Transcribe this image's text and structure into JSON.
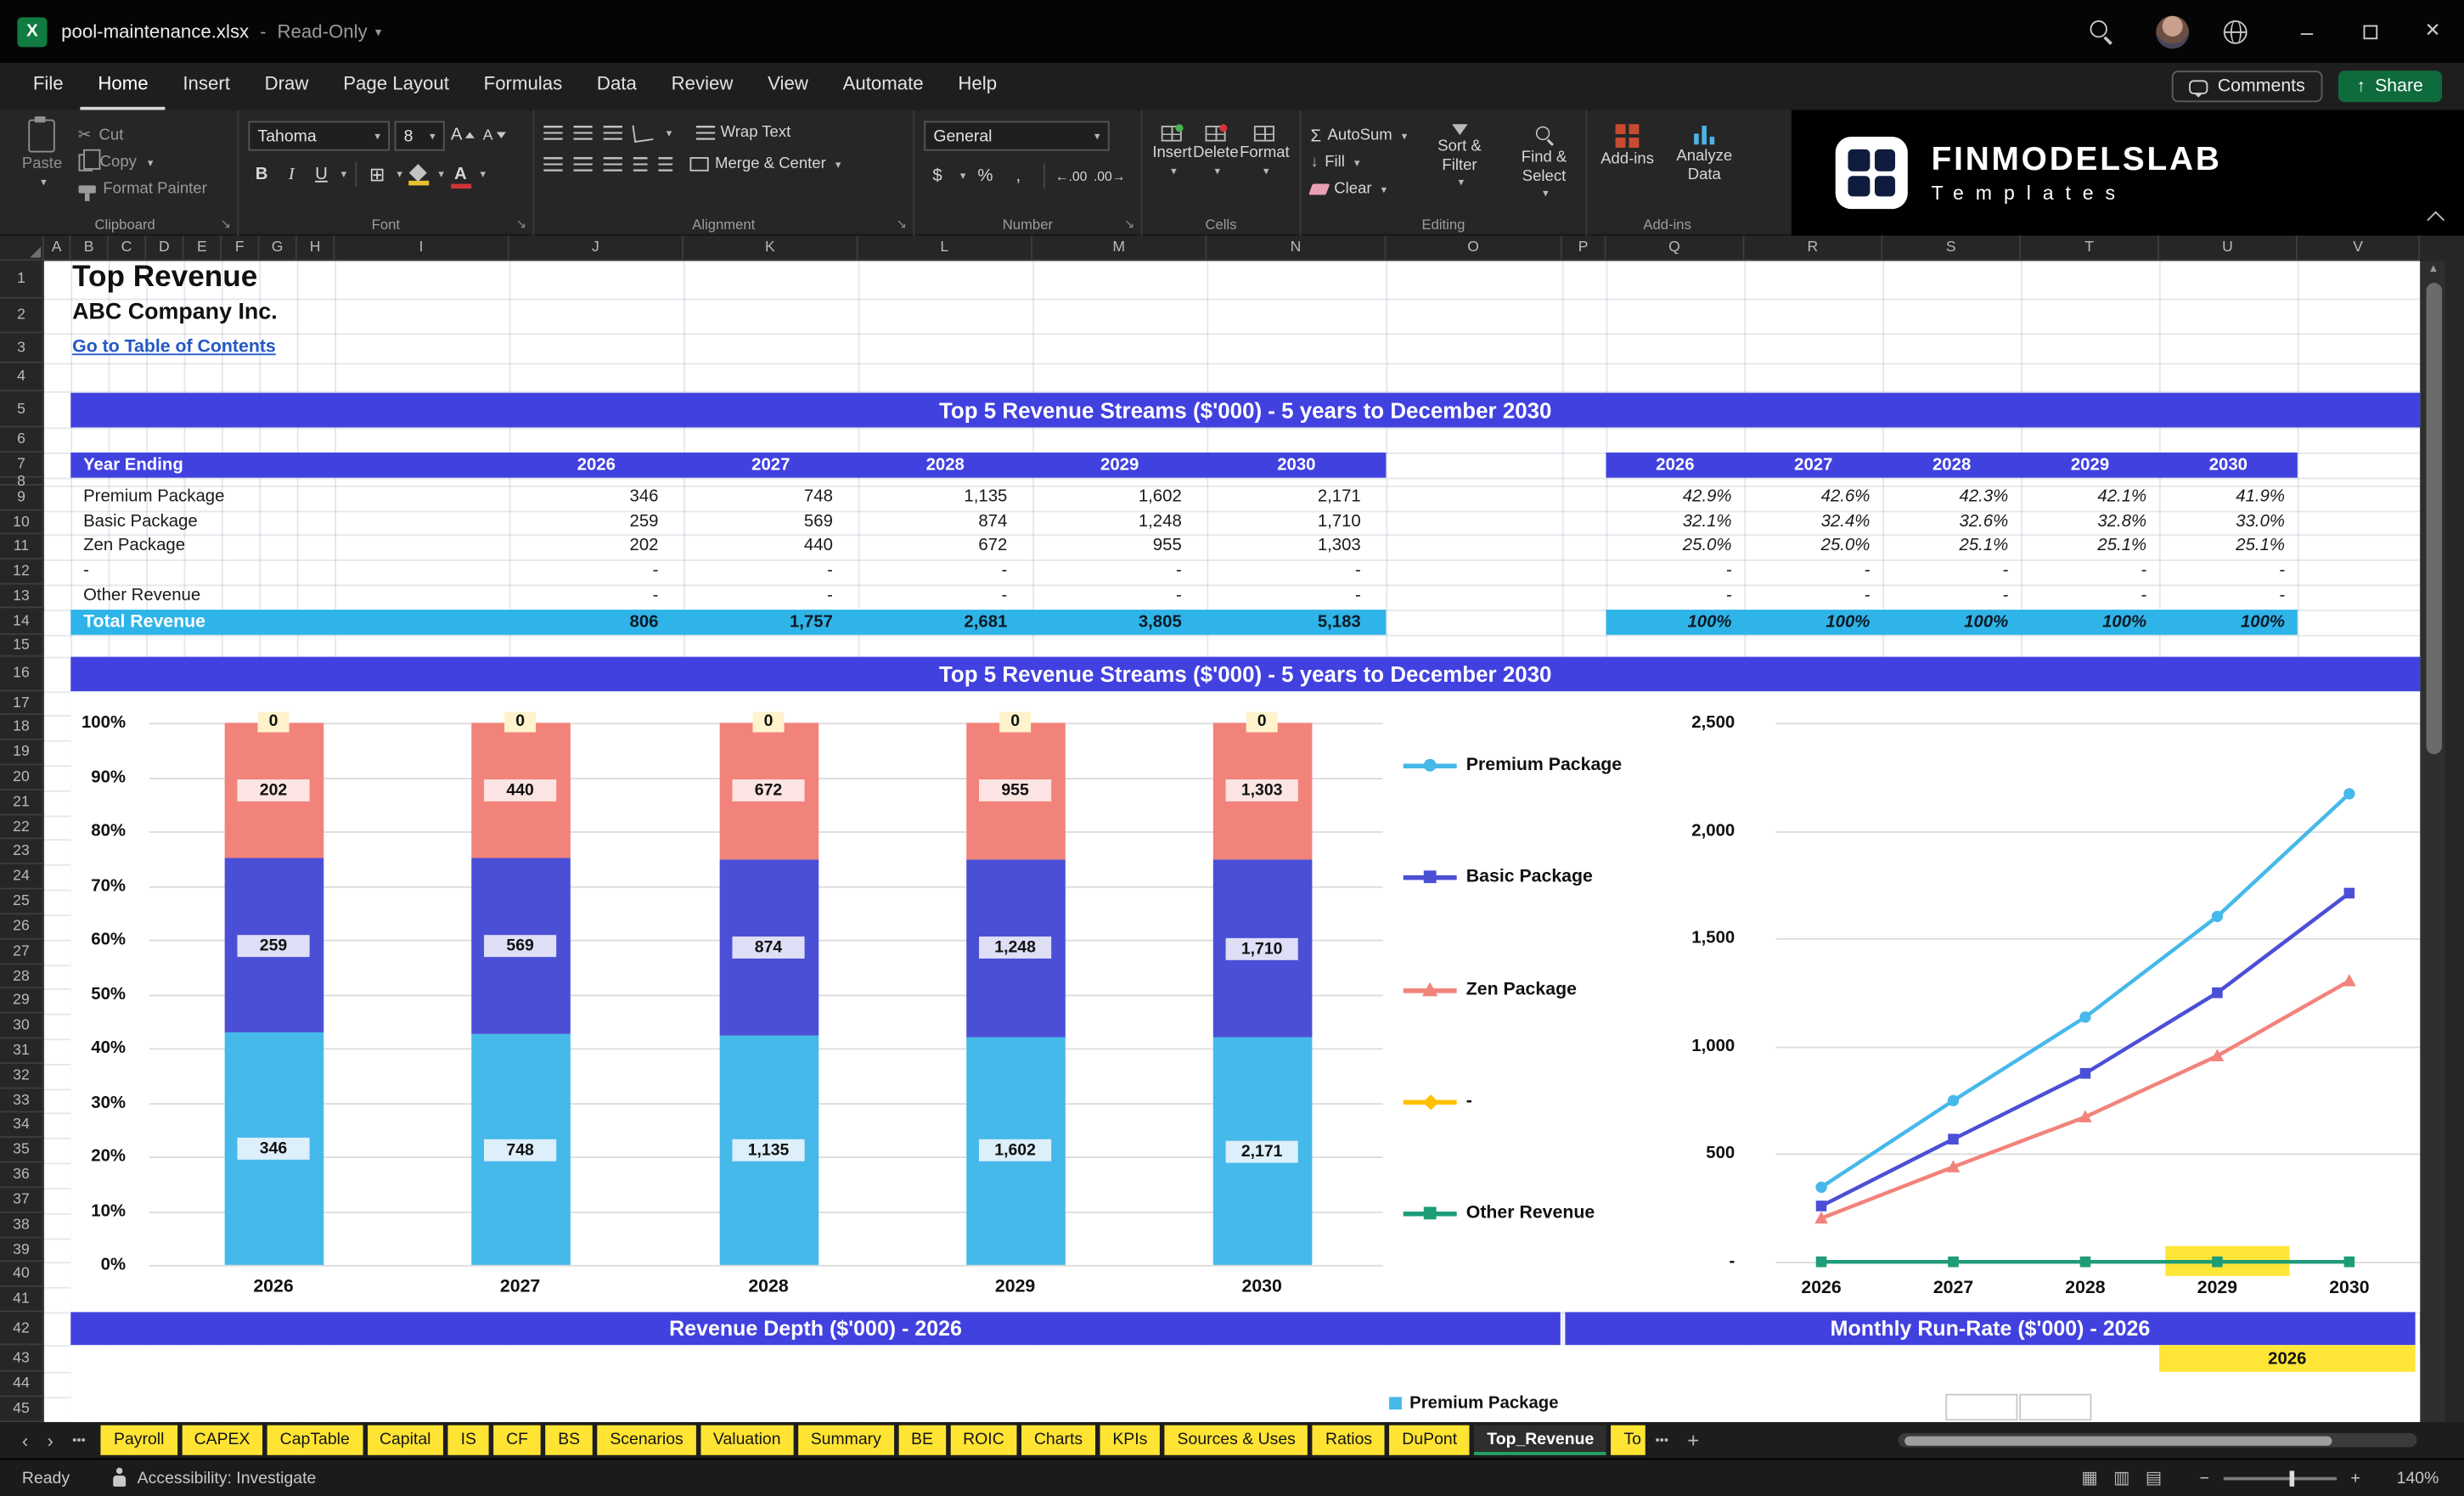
{
  "colors": {
    "banner_blue": "#4141E0",
    "total_cyan": "#2EB4E8",
    "premium_blue": "#45B9E9",
    "basic_indigo": "#4B4FD6",
    "zen_salmon": "#F2837B",
    "dash_yellow": "#FFC000",
    "other_green": "#1E9C78",
    "tab_yellow": "#FFE433",
    "highlight_yellow": "#FFE535",
    "link_blue": "#2257C5"
  },
  "title_bar": {
    "filename": "pool-maintenance.xlsx",
    "dash": "-",
    "mode": "Read-Only"
  },
  "menu": {
    "items": [
      "File",
      "Home",
      "Insert",
      "Draw",
      "Page Layout",
      "Formulas",
      "Data",
      "Review",
      "View",
      "Automate",
      "Help"
    ],
    "active": "Home",
    "comments": "Comments",
    "share": "Share"
  },
  "ribbon": {
    "clipboard": {
      "group": "Clipboard",
      "paste": "Paste",
      "cut": "Cut",
      "copy": "Copy",
      "format_painter": "Format Painter"
    },
    "font": {
      "group": "Font",
      "name": "Tahoma",
      "size": "8",
      "bold": "B",
      "italic": "I",
      "underline": "U",
      "grow": "A",
      "shrink": "A"
    },
    "alignment": {
      "group": "Alignment",
      "wrap": "Wrap Text",
      "merge": "Merge & Center"
    },
    "number": {
      "group": "Number",
      "format": "General",
      "currency": "$",
      "percent": "%",
      "comma": ",",
      "inc_decimal": "←.00",
      "dec_decimal": ".00→"
    },
    "cells": {
      "group": "Cells",
      "insert": "Insert",
      "delete": "Delete",
      "format": "Format"
    },
    "editing": {
      "group": "Editing",
      "autosum": "AutoSum",
      "fill": "Fill",
      "clear": "Clear",
      "sort": "Sort & Filter",
      "find": "Find & Select"
    },
    "addins": {
      "group": "Add-ins",
      "addins": "Add-ins",
      "analyze": "Analyze Data"
    },
    "brand": {
      "name": "FINMODELSLAB",
      "sub": "Templates"
    }
  },
  "grid": {
    "columns": [
      "A",
      "B",
      "C",
      "D",
      "E",
      "F",
      "G",
      "H",
      "I",
      "J",
      "K",
      "L",
      "M",
      "N",
      "O",
      "P",
      "Q",
      "R",
      "S",
      "T",
      "U",
      "V"
    ],
    "row_from": 1,
    "row_to": 45
  },
  "sheet": {
    "title": "Top Revenue",
    "company": "ABC Company Inc.",
    "toc_link": "Go to Table of Contents",
    "banner_top": "Top 5 Revenue Streams ($'000) - 5 years to December 2030",
    "banner_chart": "Top 5 Revenue Streams ($'000) - 5 years to December 2030",
    "banner_depth": "Revenue Depth ($'000) - 2026",
    "banner_runrate": "Monthly Run-Rate ($'000) - 2026",
    "year_cell": "2026",
    "partial_legend": "Premium Package",
    "table": {
      "header": "Year Ending",
      "years": [
        "2026",
        "2027",
        "2028",
        "2029",
        "2030"
      ],
      "rows": [
        {
          "label": "Premium Package",
          "values": [
            "346",
            "748",
            "1,135",
            "1,602",
            "2,171"
          ],
          "pcts": [
            "42.9%",
            "42.6%",
            "42.3%",
            "42.1%",
            "41.9%"
          ]
        },
        {
          "label": "Basic Package",
          "values": [
            "259",
            "569",
            "874",
            "1,248",
            "1,710"
          ],
          "pcts": [
            "32.1%",
            "32.4%",
            "32.6%",
            "32.8%",
            "33.0%"
          ]
        },
        {
          "label": "Zen Package",
          "values": [
            "202",
            "440",
            "672",
            "955",
            "1,303"
          ],
          "pcts": [
            "25.0%",
            "25.0%",
            "25.1%",
            "25.1%",
            "25.1%"
          ]
        },
        {
          "label": "-",
          "values": [
            "-",
            "-",
            "-",
            "-",
            "-"
          ],
          "pcts": [
            "-",
            "-",
            "-",
            "-",
            "-"
          ]
        },
        {
          "label": "Other Revenue",
          "values": [
            "-",
            "-",
            "-",
            "-",
            "-"
          ],
          "pcts": [
            "-",
            "-",
            "-",
            "-",
            "-"
          ]
        }
      ],
      "total": {
        "label": "Total Revenue",
        "values": [
          "806",
          "1,757",
          "2,681",
          "3,805",
          "5,183"
        ],
        "pcts": [
          "100%",
          "100%",
          "100%",
          "100%",
          "100%"
        ]
      }
    }
  },
  "chart_data": [
    {
      "type": "bar",
      "subtype": "stacked_100pct",
      "title": "Top 5 Revenue Streams ($'000) - 5 years to December 2030",
      "categories": [
        "2026",
        "2027",
        "2028",
        "2029",
        "2030"
      ],
      "series": [
        {
          "name": "Premium Package",
          "values": [
            346,
            748,
            1135,
            1602,
            2171
          ],
          "pct": [
            42.9,
            42.6,
            42.3,
            42.1,
            41.9
          ],
          "labels": [
            "346",
            "748",
            "1,135",
            "1,602",
            "2,171"
          ],
          "color": "#45B9E9",
          "label_bg": "#DCEFFA"
        },
        {
          "name": "Basic Package",
          "values": [
            259,
            569,
            874,
            1248,
            1710
          ],
          "pct": [
            32.1,
            32.4,
            32.6,
            32.8,
            33.0
          ],
          "labels": [
            "259",
            "569",
            "874",
            "1,248",
            "1,710"
          ],
          "color": "#4B4FD6",
          "label_bg": "#DEDFF7"
        },
        {
          "name": "Zen Package",
          "values": [
            202,
            440,
            672,
            955,
            1303
          ],
          "pct": [
            25.0,
            25.0,
            25.1,
            25.1,
            25.1
          ],
          "labels": [
            "202",
            "440",
            "672",
            "955",
            "1,303"
          ],
          "color": "#F2837B",
          "label_bg": "#FBE4E1"
        },
        {
          "name": "-",
          "values": [
            0,
            0,
            0,
            0,
            0
          ],
          "pct": [
            0,
            0,
            0,
            0,
            0
          ],
          "labels": [
            "0",
            "0",
            "0",
            "0",
            "0"
          ],
          "color": "#FFC000",
          "label_bg": "#FFF3CC"
        },
        {
          "name": "Other Revenue",
          "values": [
            0,
            0,
            0,
            0,
            0
          ],
          "pct": [
            0,
            0,
            0,
            0,
            0
          ],
          "labels": [],
          "color": "#1E9C78",
          "label_bg": "#DFF2EB"
        }
      ],
      "y_ticks": [
        "100%",
        "90%",
        "80%",
        "70%",
        "60%",
        "50%",
        "40%",
        "30%",
        "20%",
        "10%",
        "0%"
      ],
      "ylim": [
        0,
        100
      ],
      "grid": true,
      "legend": [
        "Premium Package",
        "Basic Package",
        "Zen Package",
        "-",
        "Other Revenue"
      ],
      "legend_position": "right"
    },
    {
      "type": "line",
      "categories": [
        "2026",
        "2027",
        "2028",
        "2029",
        "2030"
      ],
      "series": [
        {
          "name": "Premium Package",
          "values": [
            346,
            748,
            1135,
            1602,
            2171
          ],
          "color": "#45B9E9",
          "marker": "circle"
        },
        {
          "name": "Basic Package",
          "values": [
            259,
            569,
            874,
            1248,
            1710
          ],
          "color": "#4B4FD6",
          "marker": "square"
        },
        {
          "name": "Zen Package",
          "values": [
            202,
            440,
            672,
            955,
            1303
          ],
          "color": "#F2837B",
          "marker": "triangle"
        },
        {
          "name": "Other Revenue",
          "values": [
            0,
            0,
            0,
            0,
            0
          ],
          "color": "#1E9C78",
          "marker": "square"
        }
      ],
      "y_ticks": [
        "2,500",
        "2,000",
        "1,500",
        "1,000",
        "500",
        "-"
      ],
      "ylim": [
        0,
        2500
      ],
      "grid": true
    }
  ],
  "tabs": {
    "prev": "‹",
    "next": "›",
    "overflow": "•••",
    "items": [
      {
        "label": "Payroll"
      },
      {
        "label": "CAPEX"
      },
      {
        "label": "CapTable"
      },
      {
        "label": "Capital"
      },
      {
        "label": "IS"
      },
      {
        "label": "CF"
      },
      {
        "label": "BS"
      },
      {
        "label": "Scenarios"
      },
      {
        "label": "Valuation"
      },
      {
        "label": "Summary"
      },
      {
        "label": "BE"
      },
      {
        "label": "ROIC"
      },
      {
        "label": "Charts"
      },
      {
        "label": "KPIs"
      },
      {
        "label": "Sources & Uses"
      },
      {
        "label": "Ratios"
      },
      {
        "label": "DuPont"
      },
      {
        "label": "Top_Revenue",
        "active": true
      },
      {
        "label": "To",
        "partial": true
      }
    ],
    "more": "•••",
    "add": "+"
  },
  "status_bar": {
    "ready": "Ready",
    "accessibility": "Accessibility: Investigate",
    "zoom_out": "−",
    "zoom_in": "+",
    "zoom": "140%"
  }
}
